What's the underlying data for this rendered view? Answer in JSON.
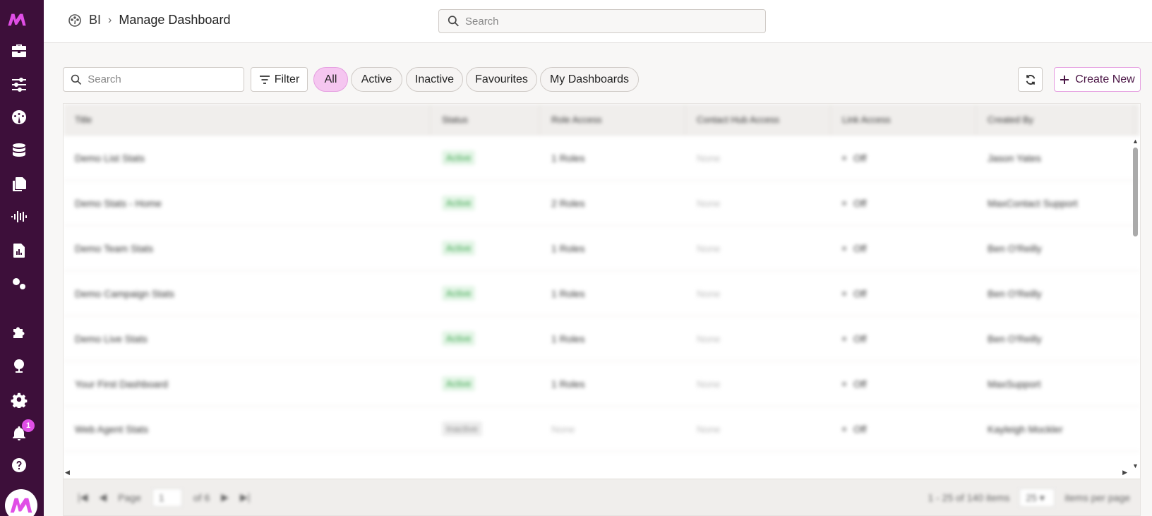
{
  "sidebar": {
    "logo": "maxcontact-logo",
    "icons": [
      "toolbox-icon",
      "sliders-icon",
      "dashboard-icon",
      "database-icon",
      "documents-icon",
      "audio-waveform-icon",
      "report-icon",
      "gears-icon",
      "puzzle-icon",
      "globe-icon",
      "settings-icon",
      "bell-icon",
      "help-icon"
    ],
    "notification_count": "1"
  },
  "header": {
    "breadcrumb_root": "BI",
    "breadcrumb_sep": "›",
    "breadcrumb_current": "Manage Dashboard",
    "search_placeholder": "Search"
  },
  "toolbar": {
    "search_placeholder": "Search",
    "filter_label": "Filter",
    "chips": [
      "All",
      "Active",
      "Inactive",
      "Favourites",
      "My Dashboards"
    ],
    "active_chip": "All",
    "create_label": "Create New"
  },
  "table": {
    "columns": [
      "Title",
      "Status",
      "Role Access",
      "Contact Hub Access",
      "Link Access",
      "Created By"
    ],
    "rows": [
      {
        "title": "Demo List Stats",
        "status": "Active",
        "role": "1 Roles",
        "hub": "None",
        "link": "Off",
        "creator": "Jason Yates"
      },
      {
        "title": "Demo Stats - Home",
        "status": "Active",
        "role": "2 Roles",
        "hub": "None",
        "link": "Off",
        "creator": "MaxContact Support"
      },
      {
        "title": "Demo Team Stats",
        "status": "Active",
        "role": "1 Roles",
        "hub": "None",
        "link": "Off",
        "creator": "Ben O'Reilly"
      },
      {
        "title": "Demo Campaign Stats",
        "status": "Active",
        "role": "1 Roles",
        "hub": "None",
        "link": "Off",
        "creator": "Ben O'Reilly"
      },
      {
        "title": "Demo Live Stats",
        "status": "Active",
        "role": "1 Roles",
        "hub": "None",
        "link": "Off",
        "creator": "Ben O'Reilly"
      },
      {
        "title": "Your First Dashboard",
        "status": "Active",
        "role": "1 Roles",
        "hub": "None",
        "link": "Off",
        "creator": "MaxSupport"
      },
      {
        "title": "Web Agent Stats",
        "status": "Inactive",
        "role": "None",
        "hub": "None",
        "link": "Off",
        "creator": "Kayleigh Mockler"
      }
    ],
    "footer": {
      "page_label": "Page",
      "page_value": "1",
      "of_label": "of 6",
      "items_summary": "1 - 25 of 140 items",
      "per_page_value": "25",
      "per_page_label": "items per page"
    }
  },
  "colors": {
    "sidebar_bg": "#3d0f3a",
    "accent": "#e04ee6",
    "chip_active_bg": "#f5c6f0"
  }
}
